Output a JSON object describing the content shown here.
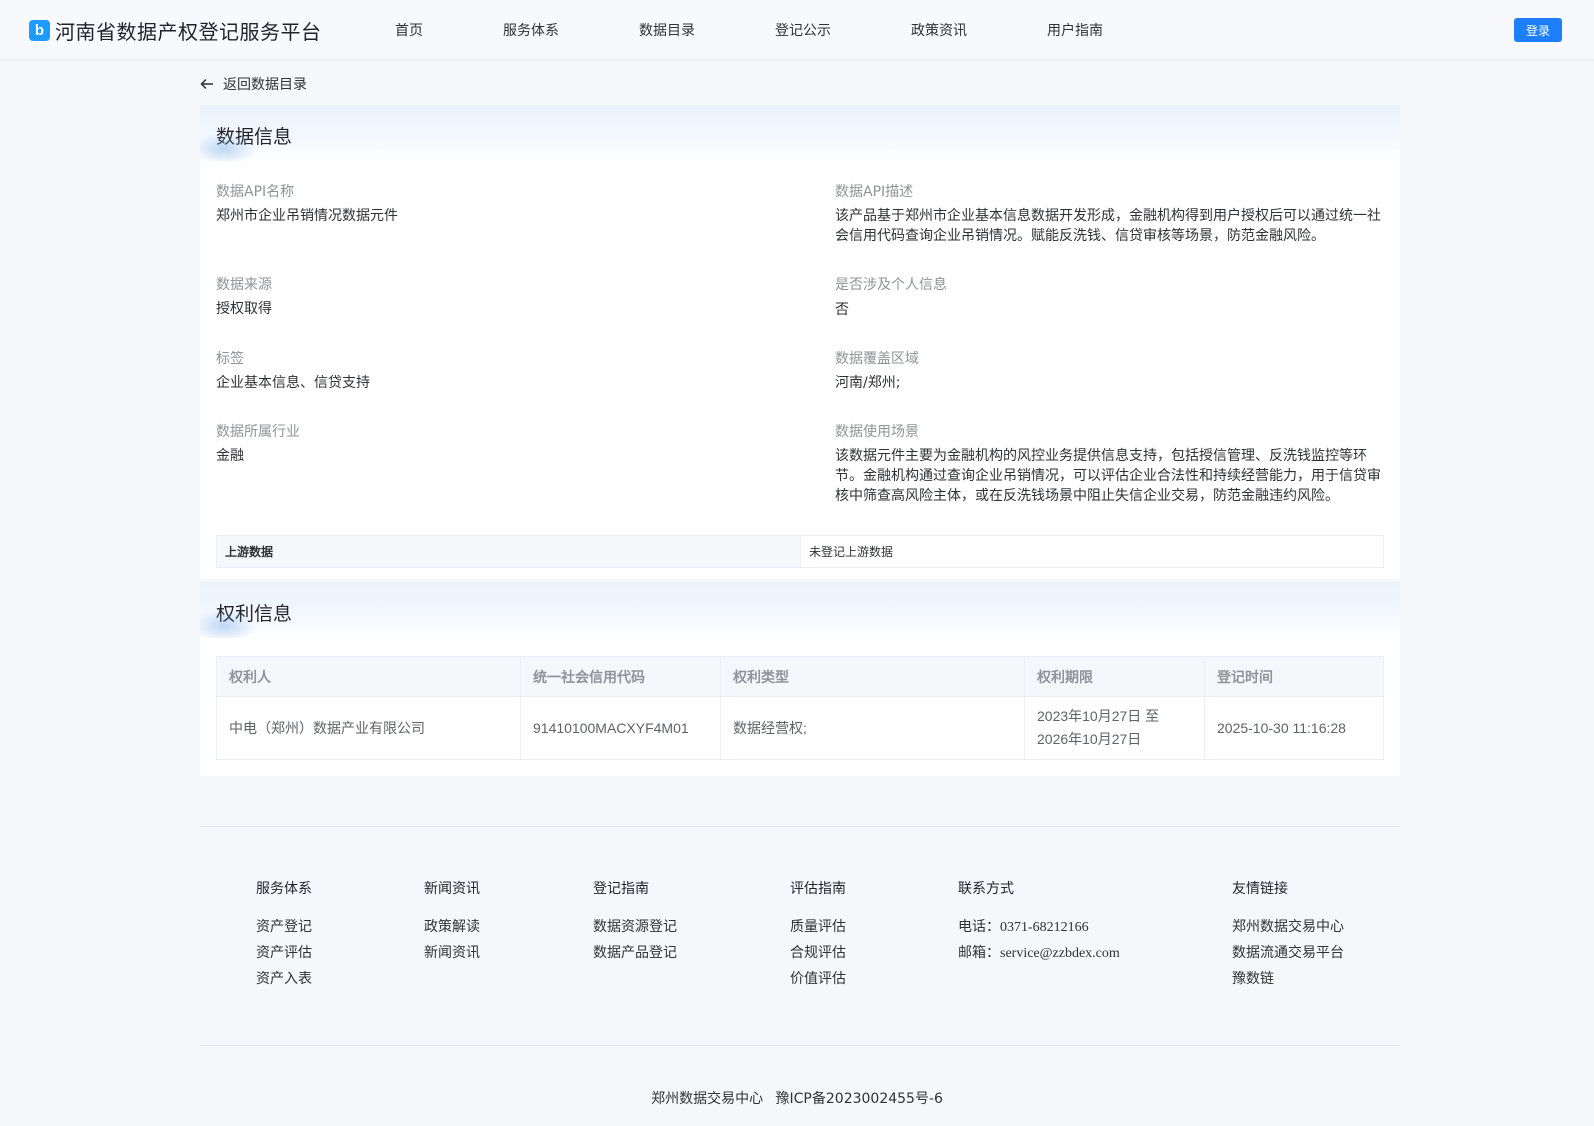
{
  "header": {
    "logo_letter": "b",
    "title": "河南省数据产权登记服务平台",
    "nav": [
      "首页",
      "服务体系",
      "数据目录",
      "登记公示",
      "政策资讯",
      "用户指南"
    ],
    "login": "登录"
  },
  "back": {
    "label": "返回数据目录"
  },
  "data_info": {
    "title": "数据信息",
    "fields": {
      "api_name": {
        "label": "数据API名称",
        "value": "郑州市企业吊销情况数据元件"
      },
      "api_desc": {
        "label": "数据API描述",
        "value_lines": [
          "该产品基于郑州市企业基本信息数据开发形成，金融机构得到用户授权后可以通过统一社",
          "会信用代码查询企业吊销情况。赋能反洗钱、信贷审核等场景，防范金融风险。"
        ]
      },
      "source": {
        "label": "数据来源",
        "value": "授权取得"
      },
      "personal": {
        "label": "是否涉及个人信息",
        "value": "否"
      },
      "tags": {
        "label": "标签",
        "value": "企业基本信息、信贷支持"
      },
      "region": {
        "label": "数据覆盖区域",
        "value": "河南/郑州;"
      },
      "industry": {
        "label": "数据所属行业",
        "value": "金融"
      },
      "scenario": {
        "label": "数据使用场景",
        "value_lines": [
          "该数据元件主要为金融机构的风控业务提供信息支持，包括授信管理、反洗钱监控等环",
          "节。金融机构通过查询企业吊销情况，可以评估企业合法性和持续经营能力，用于信贷审",
          "核中筛查高风险主体，或在反洗钱场景中阻止失信企业交易，防范金融违约风险。"
        ]
      }
    },
    "upstream": {
      "label": "上游数据",
      "value": "未登记上游数据"
    }
  },
  "rights_info": {
    "title": "权利信息",
    "columns": [
      "权利人",
      "统一社会信用代码",
      "权利类型",
      "权利期限",
      "登记时间"
    ],
    "rows": [
      {
        "holder": "中电（郑州）数据产业有限公司",
        "code": "91410100MACXYF4M01",
        "type": "数据经营权;",
        "period_start": "2023年10月27日 至",
        "period_end": "2026年10月27日",
        "time": "2025-10-30 11:16:28"
      }
    ]
  },
  "footer": {
    "columns": [
      {
        "heading": "服务体系",
        "items": [
          "资产登记",
          "资产评估",
          "资产入表"
        ]
      },
      {
        "heading": "新闻资讯",
        "items": [
          "政策解读",
          "新闻资讯"
        ]
      },
      {
        "heading": "登记指南",
        "items": [
          "数据资源登记",
          "数据产品登记"
        ]
      },
      {
        "heading": "评估指南",
        "items": [
          "质量评估",
          "合规评估",
          "价值评估"
        ]
      },
      {
        "heading": "联系方式",
        "items": [
          "电话：0371-68212166",
          "邮箱：service@zzbdex.com"
        ]
      },
      {
        "heading": "友情链接",
        "items": [
          "郑州数据交易中心",
          "数据流通交易平台",
          "豫数链"
        ]
      }
    ],
    "org": "郑州数据交易中心",
    "icp": "豫ICP备2023002455号-6"
  }
}
